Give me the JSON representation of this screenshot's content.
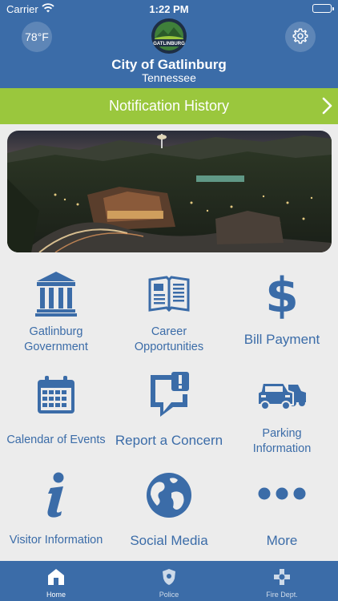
{
  "status_bar": {
    "carrier": "Carrier",
    "time": "1:22 PM"
  },
  "header": {
    "temperature": "78°F",
    "city_name": "City of Gatlinburg",
    "state": "Tennessee",
    "logo_text": "GATLINBURG"
  },
  "notification_bar": {
    "label": "Notification History",
    "color": "#9ac73d"
  },
  "colors": {
    "brand_blue": "#3b6ca8",
    "background": "#ececec"
  },
  "grid": [
    {
      "label_line1": "Gatlinburg",
      "label_line2": "Government",
      "icon": "government-building-icon"
    },
    {
      "label_line1": "Career",
      "label_line2": "Opportunities",
      "icon": "newspaper-icon"
    },
    {
      "label_line1": "Bill Payment",
      "label_line2": "",
      "icon": "dollar-icon"
    },
    {
      "label_line1": "Calendar of Events",
      "label_line2": "",
      "icon": "calendar-icon"
    },
    {
      "label_line1": "Report a Concern",
      "label_line2": "",
      "icon": "report-concern-icon"
    },
    {
      "label_line1": "Parking",
      "label_line2": "Information",
      "icon": "cars-icon"
    },
    {
      "label_line1": "Visitor Information",
      "label_line2": "",
      "icon": "info-icon"
    },
    {
      "label_line1": "Social Media",
      "label_line2": "",
      "icon": "globe-icon"
    },
    {
      "label_line1": "More",
      "label_line2": "",
      "icon": "more-dots-icon"
    }
  ],
  "tabbar": {
    "tabs": [
      {
        "label": "Home",
        "icon": "home-icon",
        "active": true
      },
      {
        "label": "Police",
        "icon": "police-badge-icon",
        "active": false
      },
      {
        "label": "Fire Dept.",
        "icon": "fire-badge-icon",
        "active": false
      }
    ]
  }
}
